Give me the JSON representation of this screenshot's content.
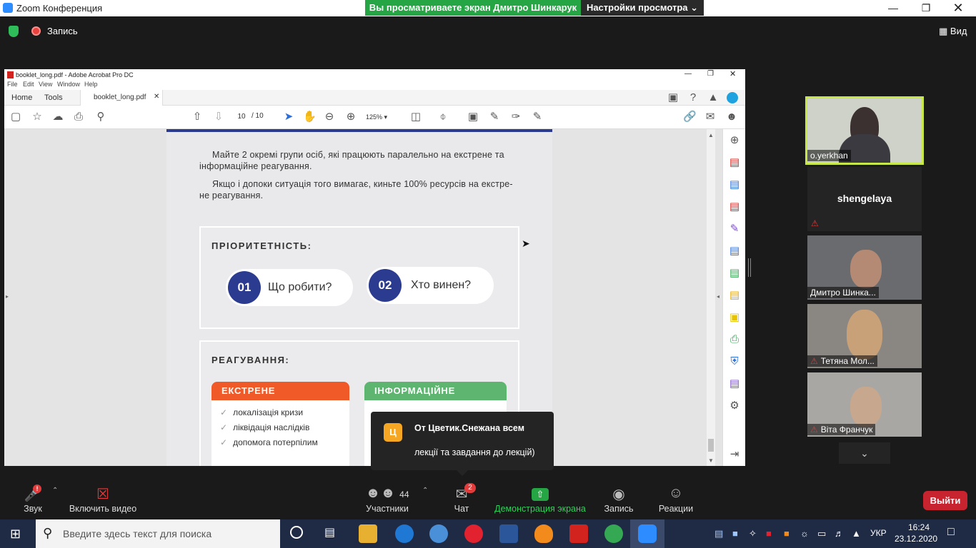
{
  "zoom": {
    "title": "Zoom Конференция",
    "share_banner": "Вы просматриваете экран Дмитро Шинкарук",
    "view_settings": "Настройки просмотра",
    "record_label": "Запись",
    "view_label": "Вид",
    "leave_label": "Выйти"
  },
  "acrobat": {
    "title": "booklet_long.pdf - Adobe Acrobat Pro DC",
    "menu": [
      "File",
      "Edit",
      "View",
      "Window",
      "Help"
    ],
    "tabs": {
      "home": "Home",
      "tools": "Tools",
      "doc": "booklet_long.pdf"
    },
    "page_current": "10",
    "page_total": "/ 10",
    "zoom": "125%"
  },
  "page": {
    "para1": "Майте 2 окремі групи осіб, які працюють паралельно на екстрене та інформаційне реагування.",
    "para2": "Якщо і допоки ситуація того вимагає, киньте 100% ресурсів на екстре-не реагування.",
    "priority_title": "ПРІОРИТЕТНІСТЬ:",
    "pill1_num": "01",
    "pill1_txt": "Що робити?",
    "pill2_num": "02",
    "pill2_txt": "Хто винен?",
    "response_title": "РЕАГУВАННЯ:",
    "card1_head": "ЕКСТРЕНЕ",
    "card2_head": "ІНФОРМАЦІЙНЕ",
    "card1_items": [
      "локалізація кризи",
      "ліквідація наслідків",
      "допомога потерпілим"
    ]
  },
  "chat_toast": {
    "avatar": "Ц",
    "from": "От Цветик.Снежана всем",
    "message": "лекції та завдання до лекцій)"
  },
  "participants": [
    {
      "name": "o.yerkhan"
    },
    {
      "name": "shengelaya"
    },
    {
      "name": "Дмитро Шинка..."
    },
    {
      "name": "Тетяна Мол..."
    },
    {
      "name": "Віта Франчук"
    }
  ],
  "controls": {
    "audio": "Звук",
    "video": "Включить видео",
    "participants": "Участники",
    "participants_count": "44",
    "chat": "Чат",
    "chat_badge": "2",
    "share": "Демонстрация экрана",
    "record": "Запись",
    "reactions": "Реакции",
    "audio_badge": "!"
  },
  "taskbar": {
    "search_placeholder": "Введите здесь текст для поиска",
    "lang": "УКР",
    "time": "16:24",
    "date": "23.12.2020"
  },
  "colors": {
    "share_green": "#26a544",
    "page_navy": "#2b3b8f",
    "card_orange": "#f05a28",
    "card_green": "#5db56f",
    "leave_red": "#c7242f"
  }
}
